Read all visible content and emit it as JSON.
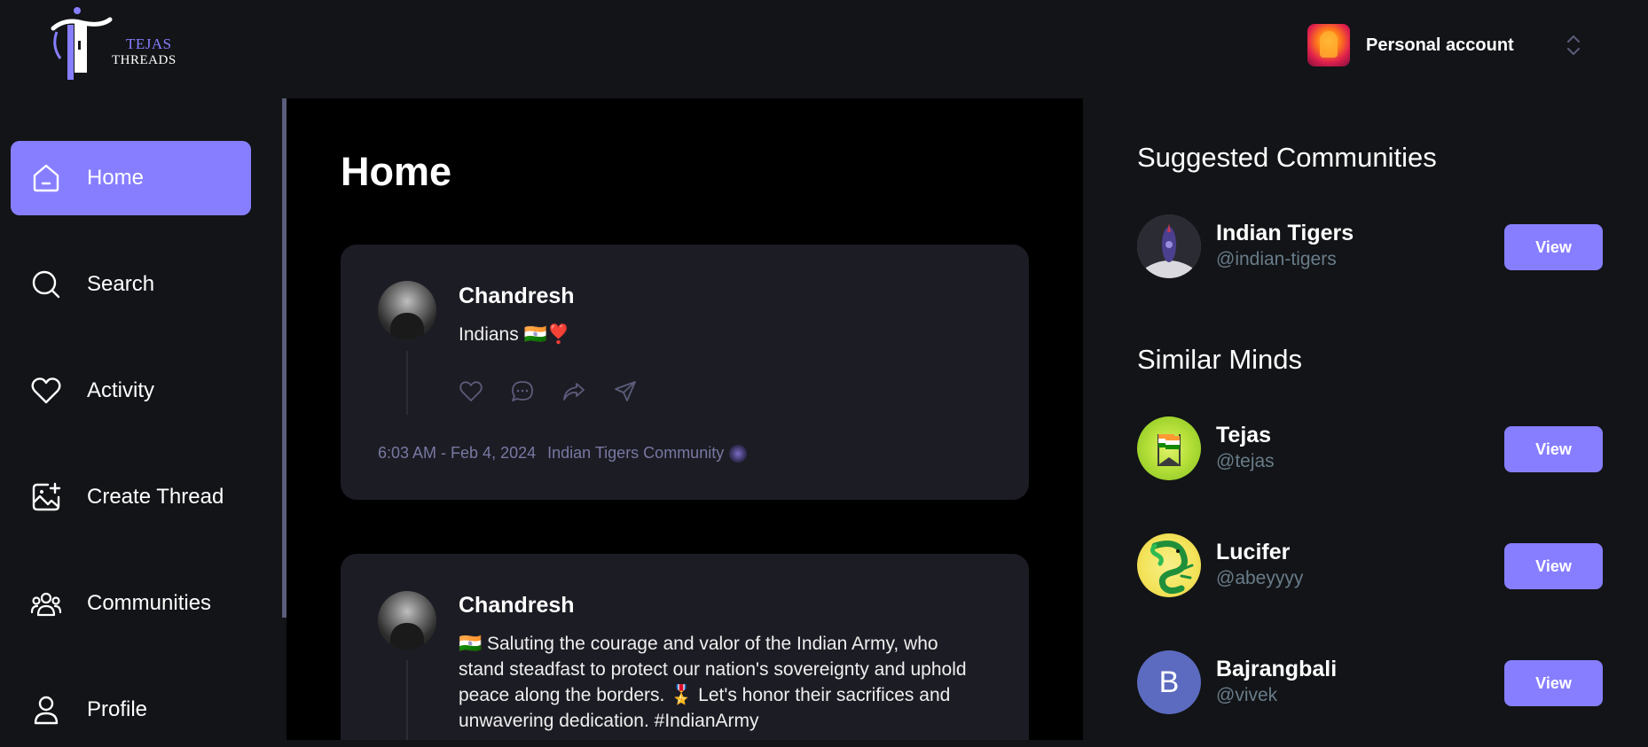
{
  "brand": {
    "line1": "TEJAS",
    "line2": "THREADS",
    "accent": "#877eff"
  },
  "account": {
    "label": "Personal account",
    "icon": "chevrons-up-down-icon"
  },
  "sidebar": {
    "items": [
      {
        "label": "Home",
        "icon": "home-icon",
        "active": true
      },
      {
        "label": "Search",
        "icon": "search-icon",
        "active": false
      },
      {
        "label": "Activity",
        "icon": "heart-icon",
        "active": false
      },
      {
        "label": "Create Thread",
        "icon": "image-plus-icon",
        "active": false
      },
      {
        "label": "Communities",
        "icon": "users-icon",
        "active": false
      },
      {
        "label": "Profile",
        "icon": "user-icon",
        "active": false
      }
    ]
  },
  "main": {
    "title": "Home",
    "posts": [
      {
        "author": "Chandresh",
        "text": "Indians 🇮🇳❣️",
        "timestamp": "6:03 AM - Feb 4, 2024",
        "community": "Indian Tigers Community"
      },
      {
        "author": "Chandresh",
        "text": "🇮🇳 Saluting the courage and valor of the Indian Army, who stand steadfast to protect our nation's sovereignty and uphold peace along the borders. 🎖️ Let's honor their sacrifices and unwavering dedication. #IndianArmy"
      }
    ]
  },
  "rightbar": {
    "communities_title": "Suggested Communities",
    "communities": [
      {
        "name": "Indian Tigers",
        "handle": "@indian-tigers",
        "button": "View"
      }
    ],
    "minds_title": "Similar Minds",
    "minds": [
      {
        "name": "Tejas",
        "handle": "@tejas",
        "button": "View"
      },
      {
        "name": "Lucifer",
        "handle": "@abeyyyy",
        "button": "View"
      },
      {
        "name": "Bajrangbali",
        "handle": "@vivek",
        "button": "View",
        "initial": "B"
      }
    ]
  }
}
